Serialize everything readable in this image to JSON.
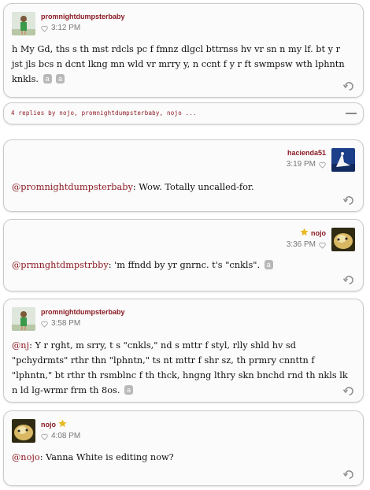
{
  "posts": [
    {
      "username": "promnightdumpsterbaby",
      "time": "3:12 PM",
      "text": "h My Gd, ths s th mst rdcls pc f fmnz dlgcl bttrnss hv vr sn n my lf. bt y r jst jls bcs n dcnt lkng mn wld vr mrry y, n ccnt f y r ft swmpsw wth lphntn knkls.",
      "chips": [
        "a",
        "a"
      ]
    },
    {
      "username": "hacienda51",
      "time": "3:19 PM",
      "mention": "@promnightdumpsterbaby",
      "text": ": Wow. Totally uncalled-for."
    },
    {
      "username": "nojo",
      "time": "3:36 PM",
      "mention": "@prmnghtdmpstrbby",
      "text": ": 'm ffndd by yr gnrnc. t's \"cnkls\".",
      "chips": [
        "a"
      ]
    },
    {
      "username": "promnightdumpsterbaby",
      "time": "3:58 PM",
      "mention": "@nj",
      "text": ": Y r rght, m srry, t s \"cnkls,\" nd s mttr f styl, rlly shld hv sd \"pchydrmts\" rthr thn \"lphntn,\" ts nt mttr f shr sz, th prmry cnnttn f \"lphntn,\" bt rthr th rsmblnc f th thck, hngng lthry skn bnchd rnd th nkls lk n ld lg-wrmr frm th 8os.",
      "chips": [
        "a"
      ]
    },
    {
      "username": "nojo",
      "time": "4:08 PM",
      "mention": "@nojo",
      "text": ": Vanna White is editing now?"
    }
  ],
  "replies_bar": {
    "text": "4 replies by nojo, promnightdumpsterbaby, nojo ..."
  },
  "colors": {
    "username": "#8b1a23",
    "star": "#e8b820",
    "chip": "#b8b8b8"
  }
}
